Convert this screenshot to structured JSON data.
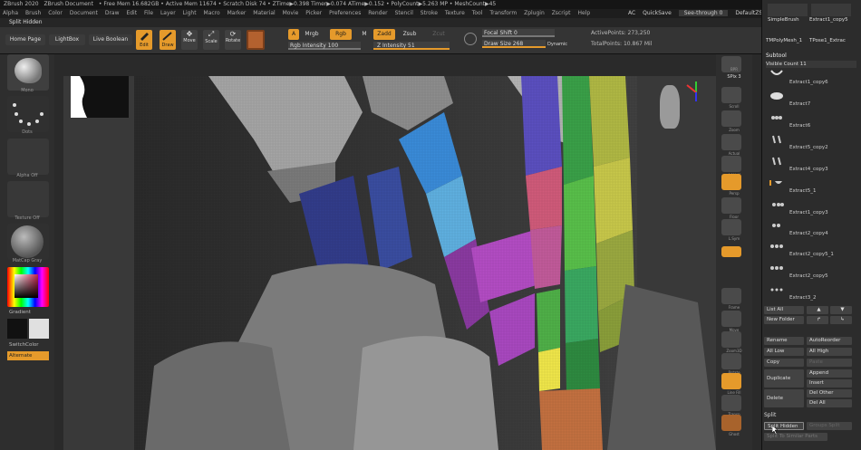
{
  "title": {
    "app": "ZBrush 2020",
    "document": "ZBrush Document",
    "mem": "• Free Mem 16.682GB • Active Mem 11674 • Scratch Disk 74 • ZTime▶0.398 Timer▶0.074 ATime▶0.152 • PolyCount▶5.263 MP • MeshCount▶45",
    "ac": "AC",
    "quicksave": "QuickSave",
    "seethrough": "See-through  0",
    "script": "DefaultZScript"
  },
  "menu": [
    "Alpha",
    "Brush",
    "Color",
    "Document",
    "Draw",
    "Edit",
    "File",
    "Layer",
    "Light",
    "Macro",
    "Marker",
    "Material",
    "Movie",
    "Picker",
    "Preferences",
    "Render",
    "Stencil",
    "Stroke",
    "Texture",
    "Tool",
    "Transform",
    "Zplugin",
    "Zscript",
    "Help"
  ],
  "subbar": {
    "label": "Split Hidden"
  },
  "toolbar": {
    "home": "Home Page",
    "lightbox": "LightBox",
    "liveboolean": "Live Boolean",
    "edit": "Edit",
    "draw": "Draw",
    "move": "Move",
    "scale": "Scale",
    "rotate": "Rotate",
    "a": "A",
    "mrgb": "Mrgb",
    "rgb": "Rgb",
    "m": "M",
    "zadd": "Zadd",
    "zsub": "Zsub",
    "zcut": "Zcut",
    "rgb_intensity": "Rgb Intensity 100",
    "z_intensity": "Z Intensity 51",
    "focal_shift": "Focal Shift 0",
    "draw_size": "Draw Size 268",
    "dynamic": "Dynamic",
    "active_points": "ActivePoints: 273,250",
    "total_points": "TotalPoints: 10.867 Mil"
  },
  "left_shelf": {
    "brush": "Mono",
    "stroke": "Dots",
    "alpha": "Alpha Off",
    "texture": "Texture Off",
    "material": "MatCap Gray",
    "gradient": "Gradient",
    "switch": "SwitchColor",
    "alternate": "Alternate"
  },
  "right_shelf": [
    "BPR",
    "SPix 3",
    "Scroll",
    "Zoom",
    "Actual",
    "AAHalf",
    "Persp",
    "Floor",
    "L.Sym",
    "Frame",
    "Move",
    "Zoom3D",
    "Rotate",
    "Line Fill",
    "Transp",
    "Ghost",
    "Solo",
    "Xpose"
  ],
  "right_panel": {
    "tools_top": [
      "SimpleBrush",
      "Extract1_copy5",
      "TMPolyMesh_1",
      "TPose1_Extrac"
    ],
    "subtool_title": "Subtool",
    "visible_count": "Visible Count 11",
    "items": [
      "Extract1_copy6",
      "Extract7",
      "Extract6",
      "Extract5_copy2",
      "Extract4_copy3",
      "Extract5_1",
      "Extract1_copy3",
      "Extract2_copy4",
      "Extract2_copy5_1",
      "Extract2_copy5",
      "Extract3_2"
    ],
    "list_all": "List All",
    "new_folder": "New Folder",
    "rename": "Rename",
    "autoreorder": "AutoReorder",
    "all_low": "All Low",
    "all_high": "All High",
    "copy": "Copy",
    "paste": "Paste",
    "duplicate": "Duplicate",
    "append": "Append",
    "insert": "Insert",
    "delete": "Delete",
    "del_other": "Del Other",
    "del_all": "Del All",
    "split": "Split",
    "split_hidden": "Split Hidden",
    "groups_split": "Groups Split",
    "split_similar": "Split To Similar Parts"
  },
  "colors": {
    "accent": "#e59a2b",
    "panel": "#2c2c2c",
    "canvas": "#393939"
  }
}
